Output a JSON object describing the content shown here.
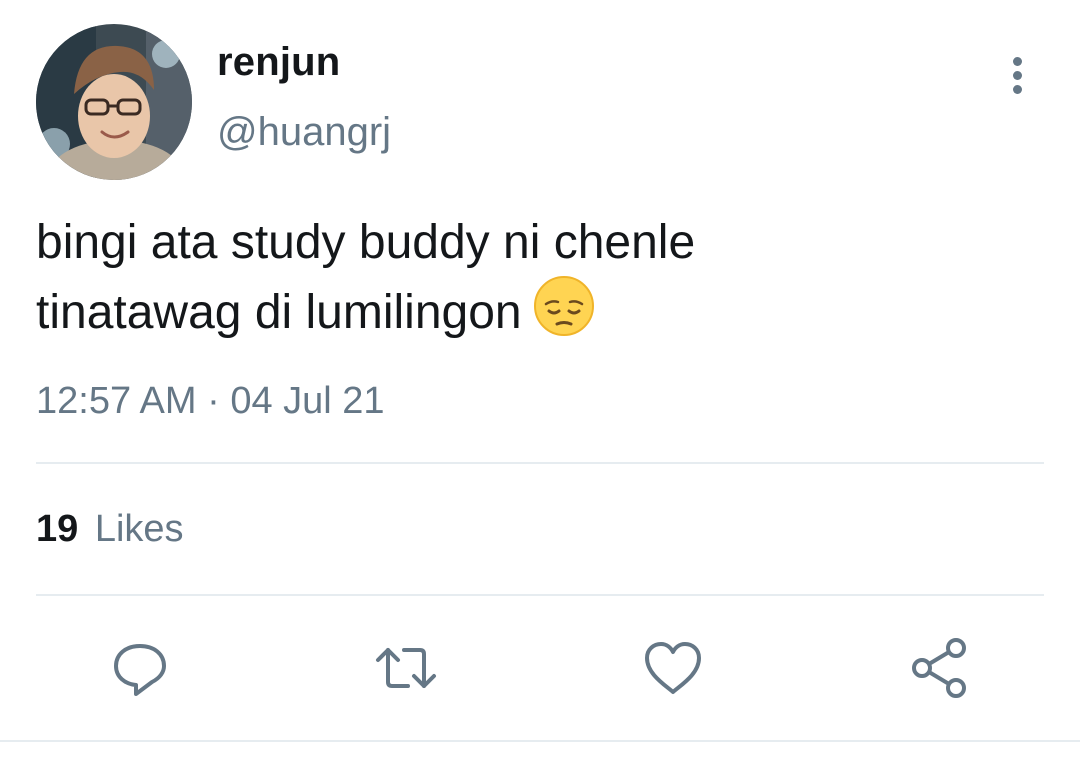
{
  "tweet": {
    "author": {
      "display_name": "renjun",
      "handle": "@huangrj"
    },
    "text_lines": [
      "bingi ata study buddy ni chenle",
      "tinatawag di lumilingon"
    ],
    "emoji": "pensive-face",
    "time": "12:57 AM",
    "separator": "·",
    "date": "04 Jul 21"
  },
  "stats": {
    "likes_count": "19",
    "likes_label": "Likes"
  },
  "actions": [
    "reply-icon",
    "retweet-icon",
    "like-icon",
    "share-icon"
  ],
  "colors": {
    "text": "#14171a",
    "secondary": "#657786",
    "divider": "#e6ecf0"
  }
}
